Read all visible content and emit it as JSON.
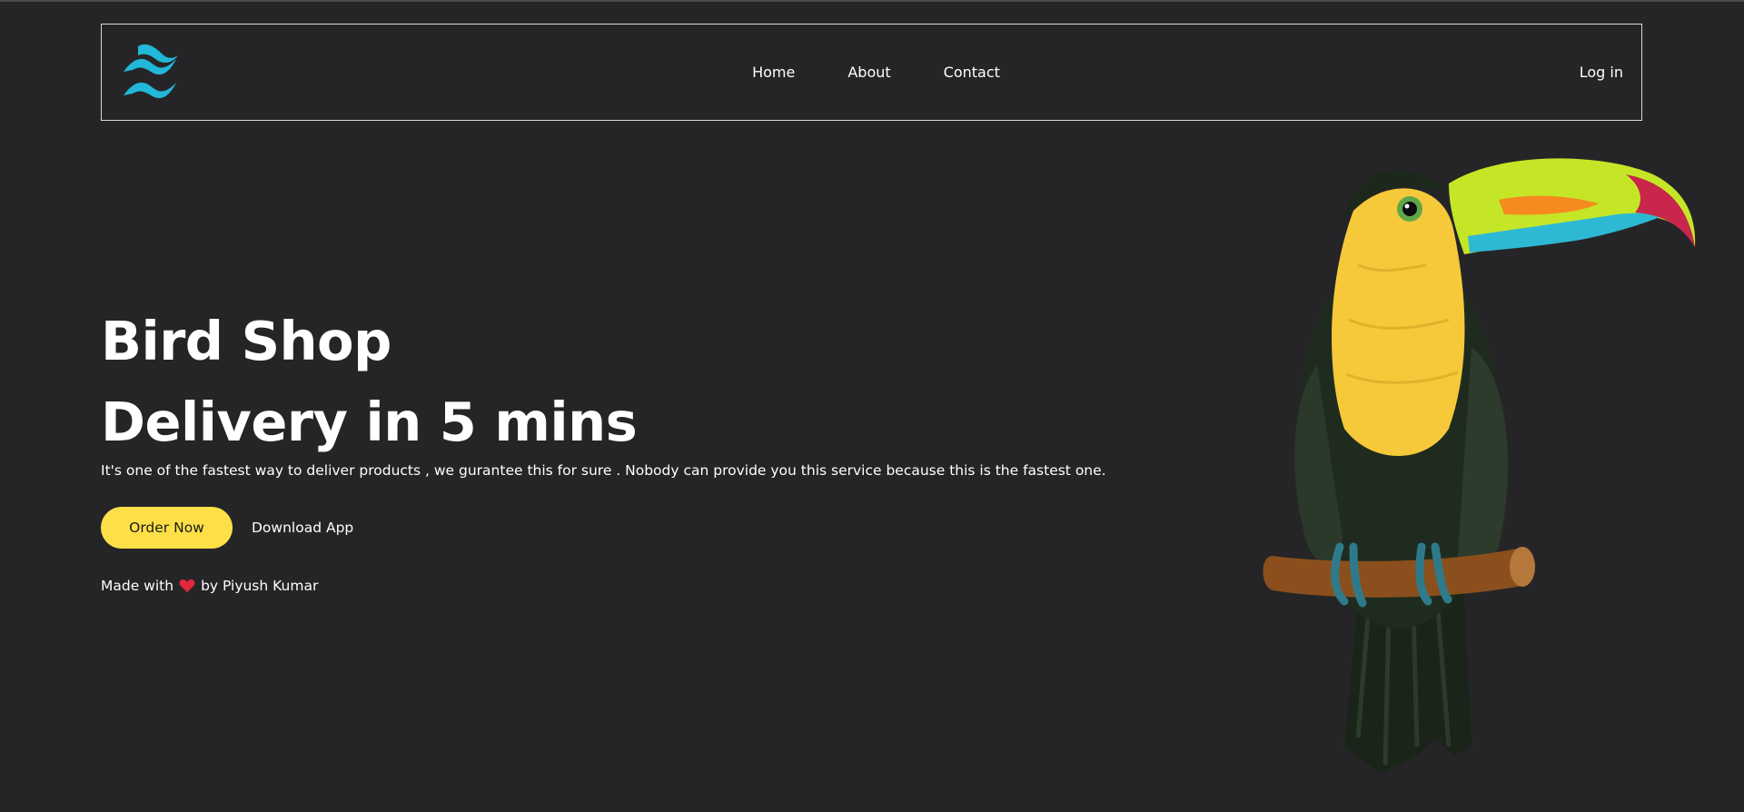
{
  "nav": {
    "logo_icon": "tailwind-wave-logo",
    "links": [
      "Home",
      "About",
      "Contact"
    ],
    "login_label": "Log in"
  },
  "hero": {
    "title_line1": "Bird Shop",
    "title_line2": "Delivery in 5 mins",
    "description": "It's one of the fastest way to deliver products , we gurantee this for sure . Nobody can provide you this service because this is the fastest one.",
    "order_button": "Order Now",
    "download_button": "Download App",
    "credit_prefix": "Made with",
    "credit_icon": "heart-icon",
    "credit_suffix": "by Piyush Kumar"
  },
  "colors": {
    "background": "#252527",
    "accent_button": "#fde047",
    "logo": "#22b8d8",
    "heart": "#e3263b"
  },
  "illustration": "toucan-on-branch"
}
